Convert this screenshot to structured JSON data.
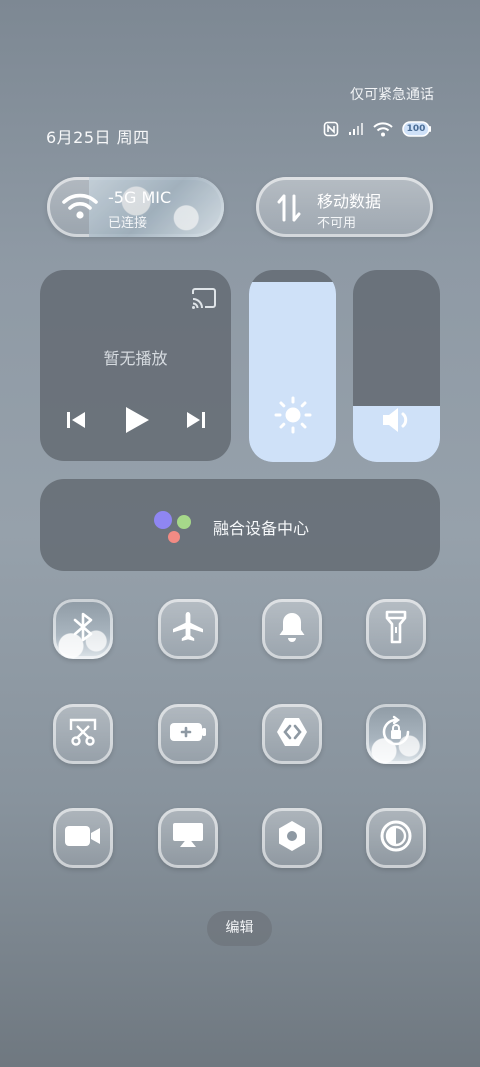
{
  "status": {
    "carrier_text": "仅可紧急通话",
    "date": "6月25日 周四",
    "battery_level": "100",
    "icons": [
      "nfc-icon",
      "signal-icon",
      "wifi-icon",
      "battery-icon"
    ]
  },
  "connectivity": {
    "wifi": {
      "name": "-5G    MIC",
      "status": "已连接",
      "icon": "wifi-icon"
    },
    "mobile_data": {
      "label": "移动数据",
      "status": "不可用",
      "icon": "data-transfer-icon"
    }
  },
  "media": {
    "status": "暂无播放",
    "icons": [
      "cast-icon",
      "previous-icon",
      "play-icon",
      "next-icon"
    ]
  },
  "sliders": {
    "brightness": {
      "level_percent": 94,
      "icon": "sun-icon"
    },
    "volume": {
      "level_percent": 29,
      "icon": "speaker-icon"
    }
  },
  "fusion": {
    "label": "融合设备中心",
    "colors": [
      "#8f86f2",
      "#a6d88a",
      "#f28b84"
    ]
  },
  "toggles": [
    {
      "name": "bluetooth",
      "icon": "bluetooth-icon",
      "art": true
    },
    {
      "name": "airplane-mode",
      "icon": "airplane-icon",
      "art": false
    },
    {
      "name": "ring-mode",
      "icon": "bell-icon",
      "art": false
    },
    {
      "name": "flashlight",
      "icon": "flashlight-icon",
      "art": false
    },
    {
      "name": "screenshot",
      "icon": "screenshot-scissors-icon",
      "art": false
    },
    {
      "name": "battery-saver",
      "icon": "battery-plus-icon",
      "art": false
    },
    {
      "name": "vpn-link",
      "icon": "link-icon",
      "art": false
    },
    {
      "name": "rotation-lock",
      "icon": "rotation-lock-icon",
      "art": true
    },
    {
      "name": "screen-record",
      "icon": "video-camera-icon",
      "art": false
    },
    {
      "name": "screen-cast",
      "icon": "screen-cast-icon",
      "art": false
    },
    {
      "name": "settings",
      "icon": "hexagon-settings-icon",
      "art": false
    },
    {
      "name": "dark-mode",
      "icon": "contrast-icon",
      "art": false
    }
  ],
  "edit": {
    "label": "编辑"
  }
}
